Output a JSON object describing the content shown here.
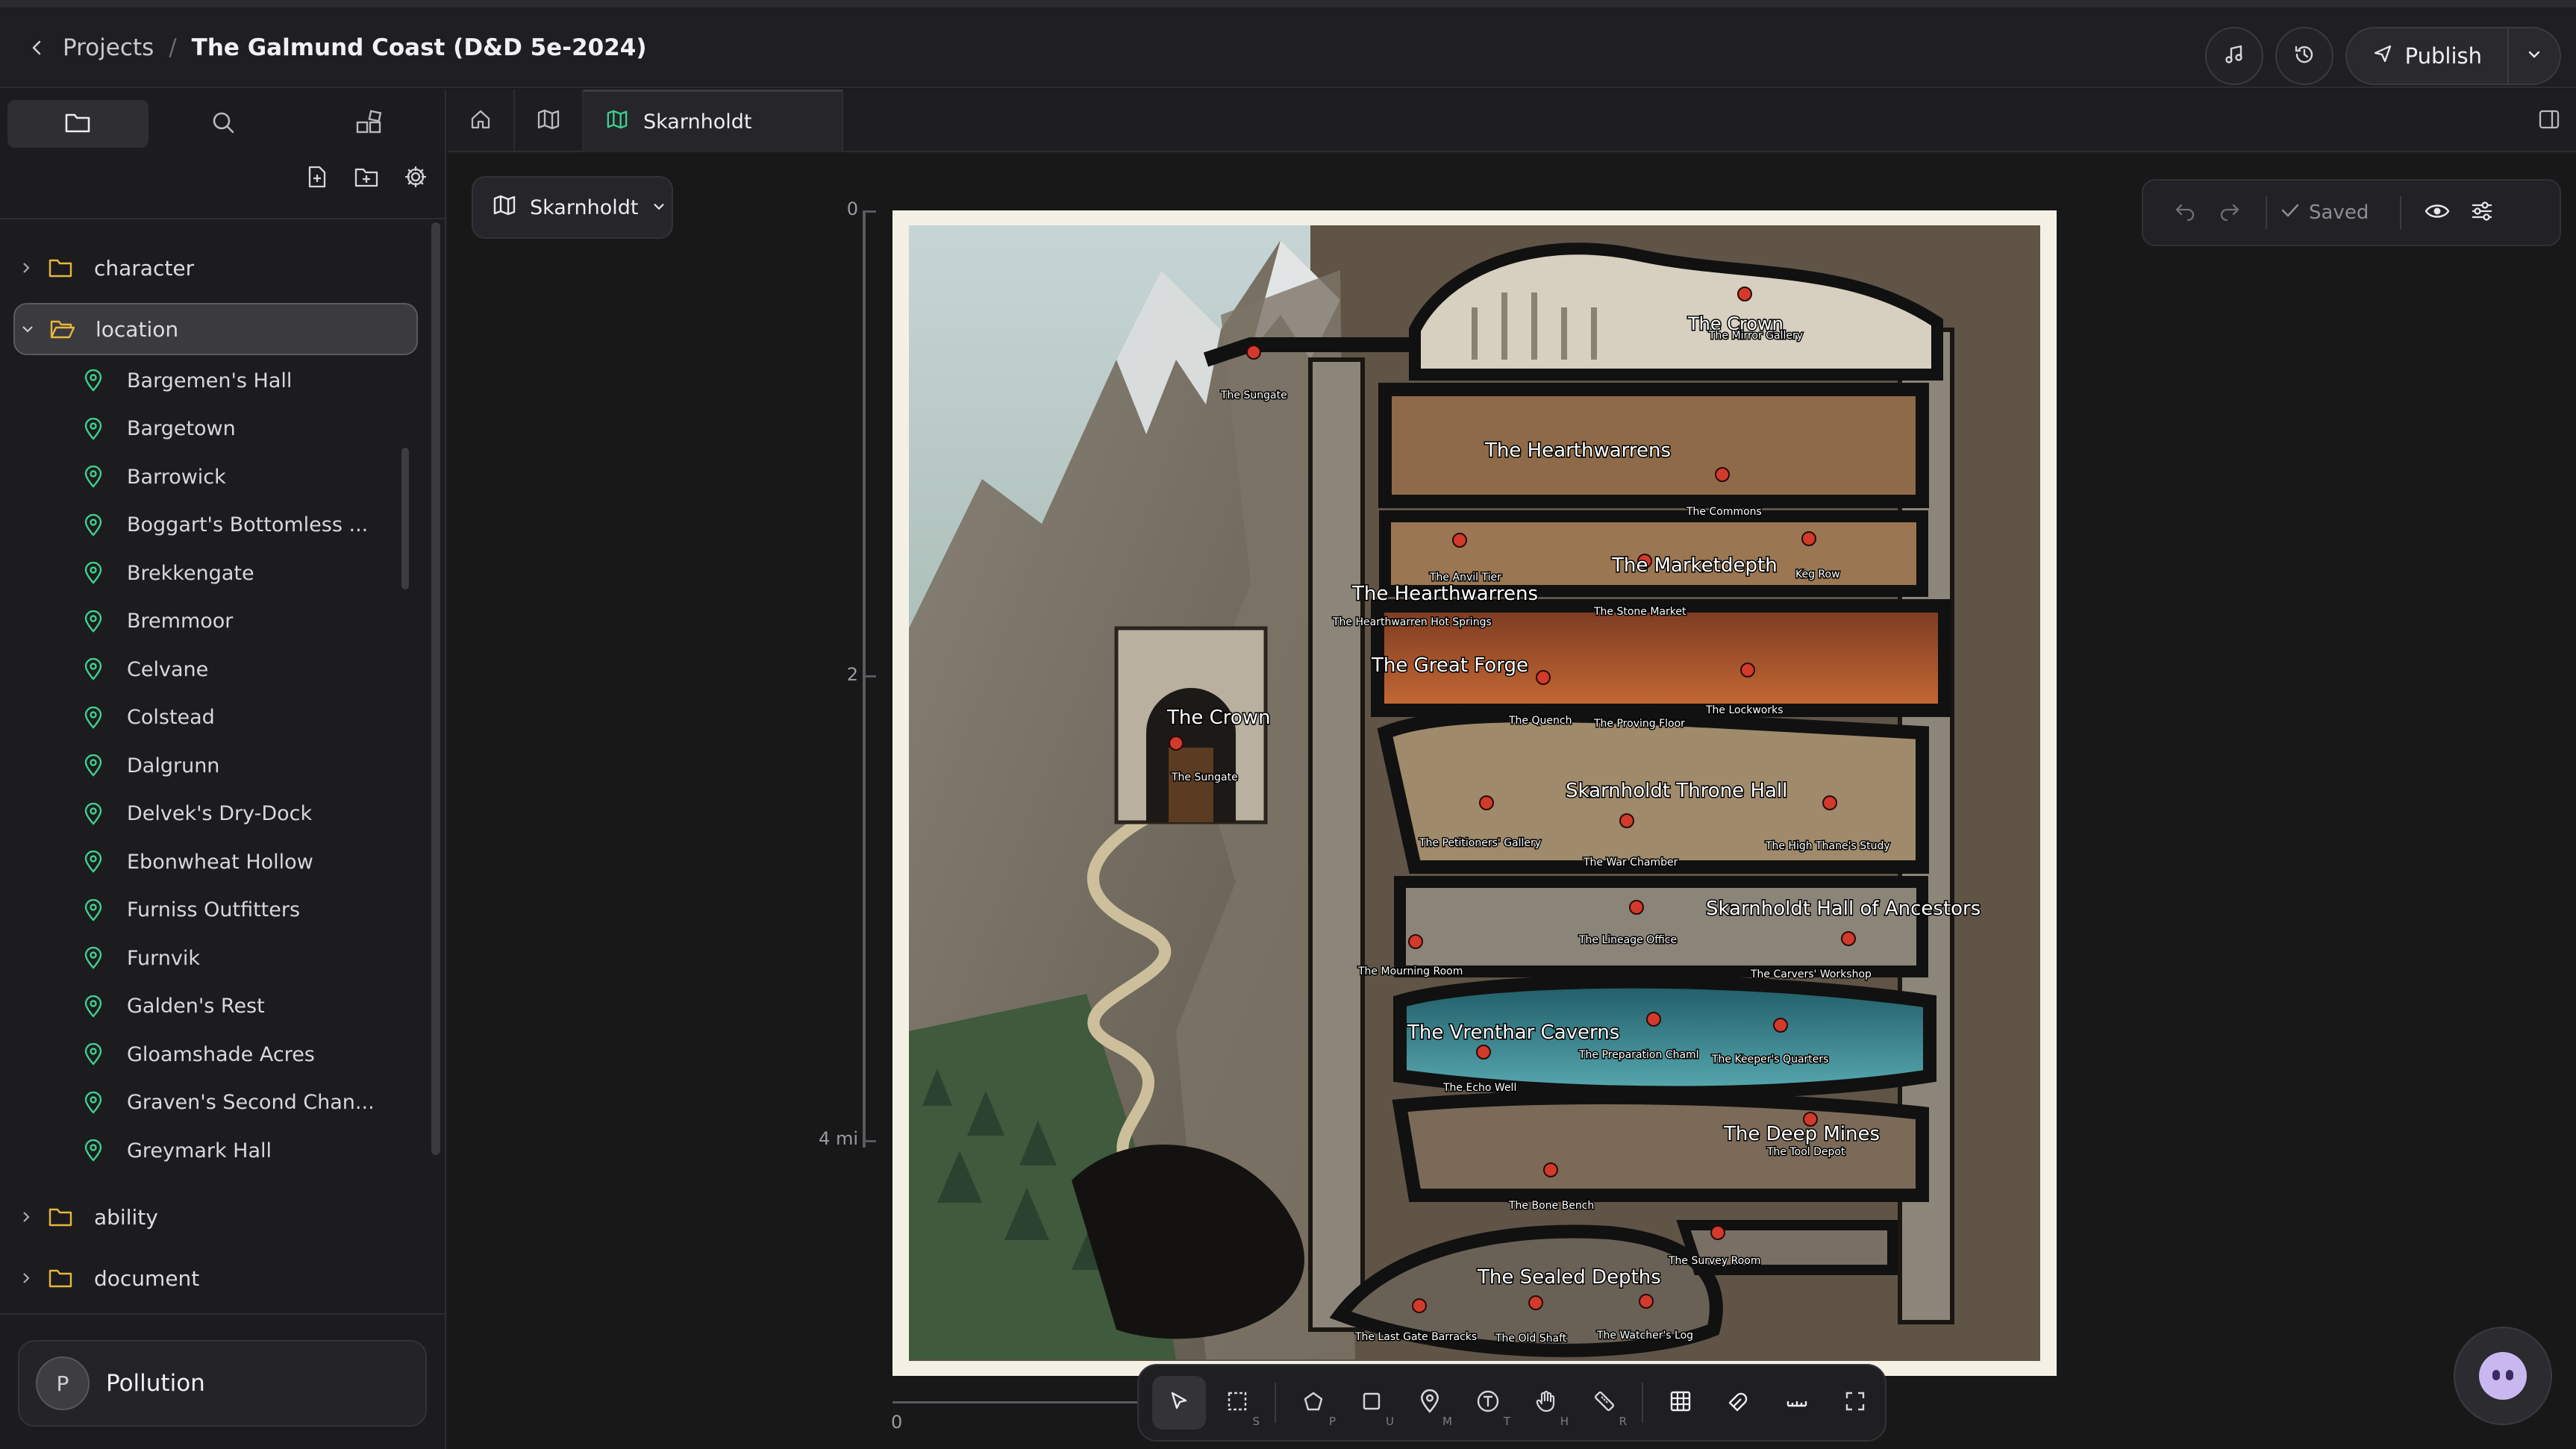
{
  "header": {
    "back_label": "Projects",
    "separator": "/",
    "project_title": "The Galmund Coast (D&D 5e-2024)",
    "publish_label": "Publish",
    "buttons": [
      "music-icon",
      "history-icon"
    ]
  },
  "sidebar": {
    "tabs": [
      "folder-icon",
      "search-icon",
      "layout-icon"
    ],
    "tools": [
      "new-file-icon",
      "new-folder-icon",
      "gear-icon"
    ],
    "folders": {
      "character": "character",
      "location": "location",
      "ability": "ability",
      "document": "document"
    },
    "locations": [
      "Bargemen's Hall",
      "Bargetown",
      "Barrowick",
      "Boggart's Bottomless ...",
      "Brekkengate",
      "Bremmoor",
      "Celvane",
      "Colstead",
      "Dalgrunn",
      "Delvek's Dry-Dock",
      "Ebonwheat Hollow",
      "Furniss Outfitters",
      "Furnvik",
      "Galden's Rest",
      "Gloamshade Acres",
      "Graven's Second Chan...",
      "Greymark Hall"
    ],
    "user": {
      "initial": "P",
      "name": "Pollution"
    }
  },
  "tabs": {
    "active_label": "Skarnholdt"
  },
  "canvas": {
    "map_selector": "Skarnholdt",
    "saved_label": "Saved",
    "ruler_v": [
      "0",
      "2",
      "4 mi"
    ],
    "ruler_h": [
      "0"
    ],
    "map_labels": {
      "crown_top": "The Crown",
      "mirror_gallery": "The Mirror Gallery",
      "sungate_top": "The Sungate",
      "hearthwarrens_top": "The Hearthwarrens",
      "commons": "The Commons",
      "anvil_tier": "The Anvil Tier",
      "marketdepth": "The Marketdepth",
      "keg_row": "Keg Row",
      "hearthwarrens_mid": "The Hearthwarrens",
      "hot_springs": "The Hearthwarren Hot Springs",
      "stone_market": "The Stone Market",
      "great_forge": "The Great Forge",
      "crown_gate": "The Crown",
      "sungate_gate": "The Sungate",
      "quench": "The Quench",
      "proving_floor": "The Proving Floor",
      "lockworks": "The Lockworks",
      "throne_hall": "Skarnholdt Throne Hall",
      "petitioners": "The Petitioners' Gallery",
      "war_chamber": "The War Chamber",
      "high_thane": "The High Thane's Study",
      "hall_ancestors": "Skarnholdt Hall of Ancestors",
      "lineage_office": "The Lineage Office",
      "mourning_room": "The Mourning Room",
      "carvers": "The Carvers' Workshop",
      "vrenthar": "The Vrenthar Caverns",
      "preparation": "The Preparation Chaml",
      "keepers": "The Keeper's Quarters",
      "echo_well": "The Echo Well",
      "deep_mines": "The Deep Mines",
      "tool_depot": "The Tool Depot",
      "bone_bench": "The Bone Bench",
      "survey_room": "The Survey Room",
      "sealed_depths": "The Sealed Depths",
      "last_gate": "The Last Gate Barracks",
      "old_shaft": "The Old Shaft",
      "watchers_log": "The Watcher's Log"
    },
    "toolbar_shortcuts": {
      "select": "S",
      "polygon": "P",
      "rect": "U",
      "marker": "M",
      "text": "T",
      "pan": "H",
      "ruler": "R"
    }
  },
  "colors": {
    "accent_pin": "#3ecf8e",
    "map_pin": "#d23a2c"
  }
}
